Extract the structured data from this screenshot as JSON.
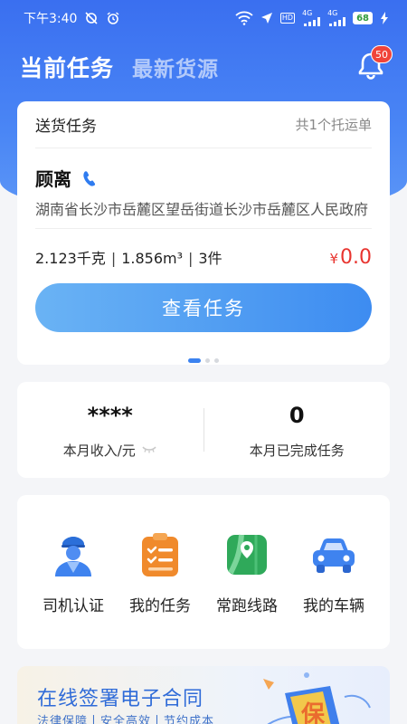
{
  "status_bar": {
    "time": "下午3:40",
    "network_1": "4G",
    "network_2": "4G",
    "hd": "HD",
    "battery": "68"
  },
  "header": {
    "tab_current": "当前任务",
    "tab_latest": "最新货源",
    "bell_badge": "50"
  },
  "task_card": {
    "type": "送货任务",
    "count": "共1个托运单",
    "contact_name": "顾离",
    "address": "湖南省长沙市岳麓区望岳街道长沙市岳麓区人民政府",
    "weight": "2.123千克",
    "volume": "1.856m³",
    "pieces": "3件",
    "separator": "|",
    "currency": "¥",
    "price": "0.0",
    "view_button": "查看任务"
  },
  "stats": {
    "income_value": "****",
    "income_label": "本月收入/元",
    "completed_value": "0",
    "completed_label": "本月已完成任务"
  },
  "menu": {
    "items": [
      {
        "label": "司机认证",
        "icon": "driver-icon"
      },
      {
        "label": "我的任务",
        "icon": "tasks-clipboard-icon"
      },
      {
        "label": "常跑线路",
        "icon": "route-map-icon"
      },
      {
        "label": "我的车辆",
        "icon": "car-icon"
      }
    ]
  },
  "banner": {
    "title": "在线签署电子合同",
    "subtitle": "法律保障丨安全高效丨节约成本",
    "art_glyph": "保"
  },
  "colors": {
    "primary": "#3b82f0",
    "price_red": "#e8342f",
    "badge_red": "#f0443a"
  }
}
